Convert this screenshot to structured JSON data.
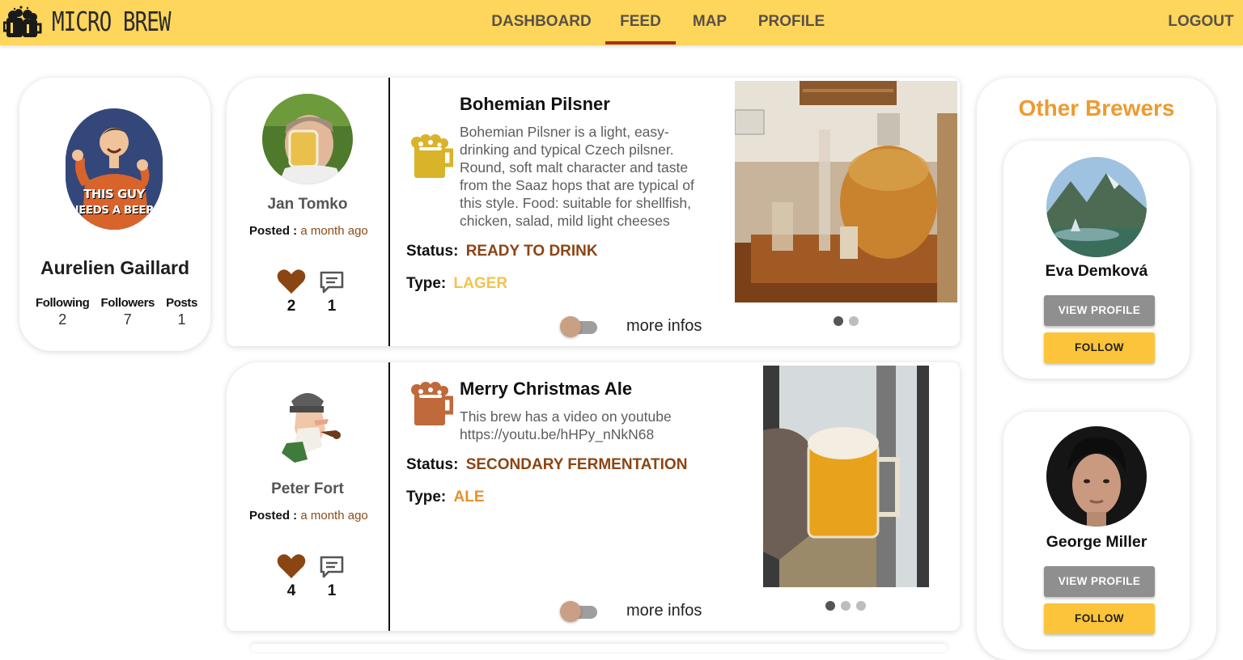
{
  "app": {
    "brand_name": "MICRO BREW"
  },
  "nav": {
    "items": [
      {
        "label": "DASHBOARD"
      },
      {
        "label": "FEED",
        "active": true
      },
      {
        "label": "MAP"
      },
      {
        "label": "PROFILE"
      }
    ],
    "logout_label": "LOGOUT"
  },
  "profile": {
    "avatar_caption_1": "THIS GUY",
    "avatar_caption_2": "NEEDS A BEER!",
    "name": "Aurelien Gaillard",
    "stats": [
      {
        "label": "Following",
        "value": "2"
      },
      {
        "label": "Followers",
        "value": "7"
      },
      {
        "label": "Posts",
        "value": "1"
      }
    ]
  },
  "posts": [
    {
      "author": "Jan Tomko",
      "posted_label": "Posted :",
      "posted_time": "a month ago",
      "likes": "2",
      "comments": "1",
      "brew_title": "Bohemian Pilsner",
      "description": "Bohemian Pilsner is a light, easy-drinking and typical Czech pilsner. Round, soft malt character and taste from the Saaz hops that are typical of this style. Food: suitable for shellfish, chicken, salad, mild light cheeses",
      "status_label": "Status:",
      "status_value": "READY TO DRINK",
      "type_label": "Type:",
      "type_value": "LAGER",
      "more_label": "more infos",
      "beer_icon_color": "#d9b32a",
      "type_color": "#f3c34b",
      "carousel": {
        "count": 2,
        "active": 1
      }
    },
    {
      "author": "Peter Fort",
      "posted_label": "Posted :",
      "posted_time": "a month ago",
      "likes": "4",
      "comments": "1",
      "brew_title": "Merry Christmas Ale",
      "description": "This brew has a video on youtube https://youtu.be/hHPy_nNkN68",
      "status_label": "Status:",
      "status_value": "SECONDARY FERMENTATION",
      "type_label": "Type:",
      "type_value": "ALE",
      "more_label": "more infos",
      "beer_icon_color": "#c0693a",
      "type_color": "#e8902b",
      "carousel": {
        "count": 3,
        "active": 1
      }
    }
  ],
  "others": {
    "title": "Other Brewers",
    "brewers": [
      {
        "name": "Eva Demková",
        "view_label": "VIEW PROFILE",
        "follow_label": "FOLLOW"
      },
      {
        "name": "George Miller",
        "view_label": "VIEW PROFILE",
        "follow_label": "FOLLOW"
      }
    ]
  },
  "colors": {
    "header": "#fed65c",
    "nav_underline": "#a92e22",
    "accent_orange": "#ef9a2e",
    "status_brown": "#8b4513",
    "heart": "#8b4513",
    "follow_button": "#fbc43a",
    "view_button": "#8f8f8f"
  },
  "icons": [
    "beer-mugs-logo-icon",
    "heart-icon",
    "comment-icon",
    "beer-mug-icon"
  ]
}
